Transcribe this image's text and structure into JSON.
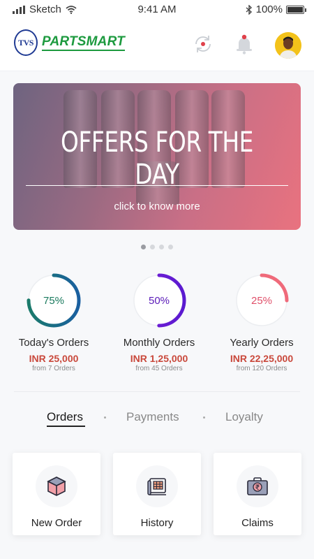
{
  "status_bar": {
    "carrier": "Sketch",
    "time": "9:41 AM",
    "battery": "100%"
  },
  "header": {
    "logo_mark": "TVS",
    "logo_text": "PARTSMART",
    "icons": [
      "refresh-icon",
      "bell-icon"
    ]
  },
  "banner": {
    "title": "OFFERS FOR THE DAY",
    "subtitle": "click to know more",
    "pages": 4,
    "active_page": 1
  },
  "stats": [
    {
      "label": "Today's Orders",
      "percent_text": "75%",
      "percent": 0.75,
      "amount": "INR 25,000",
      "from": "from 7 Orders",
      "color": "#1a7a6a",
      "color2": "#1a5fa0",
      "text_color": "#1a7a5e"
    },
    {
      "label": "Monthly Orders",
      "percent_text": "50%",
      "percent": 0.5,
      "amount": "INR 1,25,000",
      "from": "from 45 Orders",
      "color": "#7a1fd6",
      "color2": "#5a1ad0",
      "text_color": "#5a1ab8"
    },
    {
      "label": "Yearly Orders",
      "percent_text": "25%",
      "percent": 0.25,
      "amount": "INR 22,25,000",
      "from": "from 120 Orders",
      "color": "#ef6a7a",
      "color2": "#ef6a7a",
      "text_color": "#e0506a"
    }
  ],
  "tabs": [
    {
      "label": "Orders",
      "active": true
    },
    {
      "label": "Payments",
      "active": false
    },
    {
      "label": "Loyalty",
      "active": false
    }
  ],
  "cards": [
    {
      "label": "New Order",
      "icon": "box-icon"
    },
    {
      "label": "History",
      "icon": "history-icon"
    },
    {
      "label": "Claims",
      "icon": "briefcase-rupee-icon"
    }
  ]
}
